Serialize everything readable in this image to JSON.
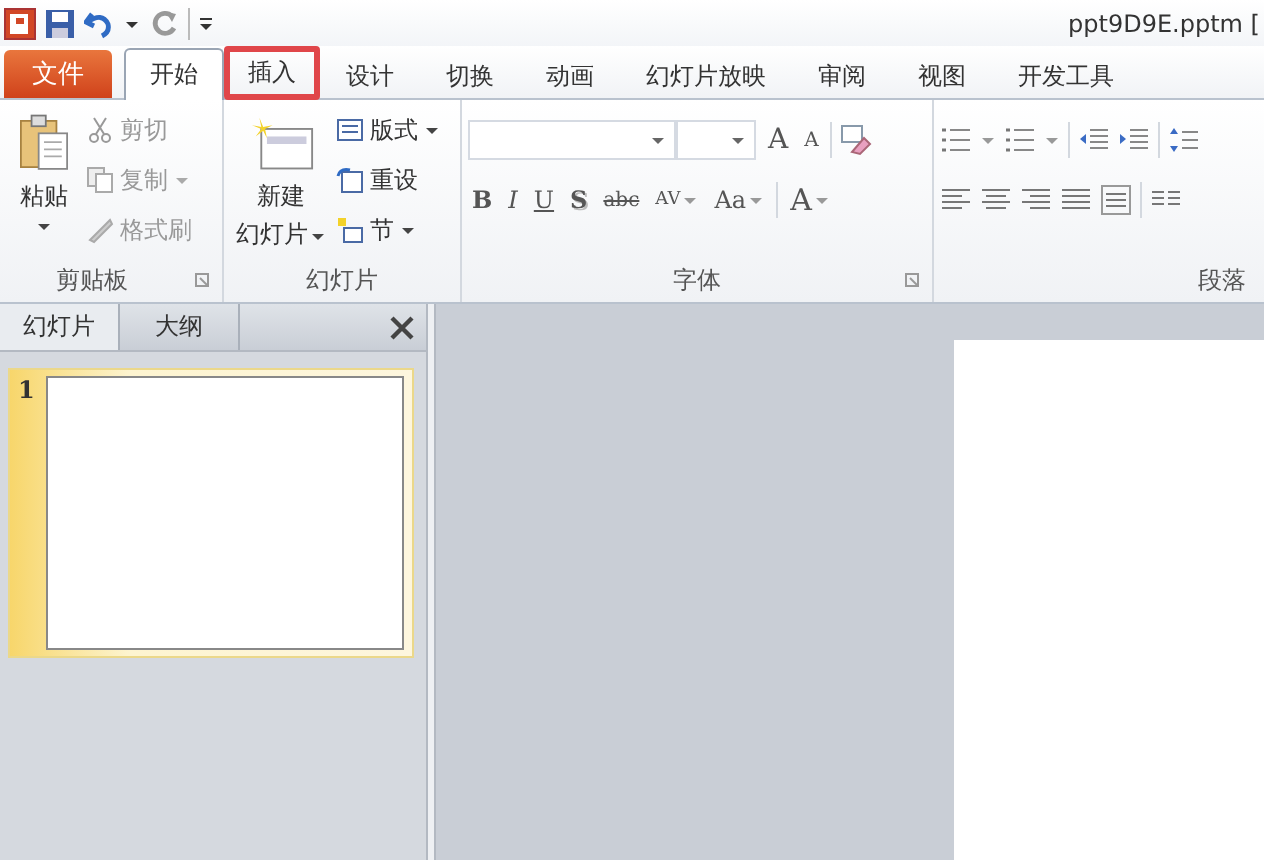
{
  "title_bar": {
    "title": "ppt9D9E.pptm ["
  },
  "file_tab": {
    "label": "文件"
  },
  "tabs": [
    {
      "label": "开始",
      "kind": "tab",
      "selected": true,
      "highlighted": false
    },
    {
      "label": "插入",
      "kind": "tab",
      "selected": false,
      "highlighted": true
    },
    {
      "label": "设计",
      "kind": "tab",
      "selected": false,
      "highlighted": false
    },
    {
      "label": "切换",
      "kind": "tab",
      "selected": false,
      "highlighted": false
    },
    {
      "label": "动画",
      "kind": "tab",
      "selected": false,
      "highlighted": false
    },
    {
      "label": "幻灯片放映",
      "kind": "tab",
      "selected": false,
      "highlighted": false
    },
    {
      "label": "审阅",
      "kind": "tab",
      "selected": false,
      "highlighted": false
    },
    {
      "label": "视图",
      "kind": "tab",
      "selected": false,
      "highlighted": false
    },
    {
      "label": "开发工具",
      "kind": "tab",
      "selected": false,
      "highlighted": false
    }
  ],
  "clipboard": {
    "label": "剪贴板",
    "paste": "粘贴",
    "items": [
      {
        "label": "剪切",
        "disabled": true,
        "dropdown": false
      },
      {
        "label": "复制",
        "disabled": true,
        "dropdown": true
      },
      {
        "label": "格式刷",
        "disabled": true,
        "dropdown": false
      }
    ]
  },
  "slides": {
    "label": "幻灯片",
    "new_slide": [
      "新建",
      "幻灯片"
    ],
    "items": [
      {
        "label": "版式",
        "dropdown": true
      },
      {
        "label": "重设",
        "dropdown": false
      },
      {
        "label": "节",
        "dropdown": true
      }
    ]
  },
  "font": {
    "label": "字体",
    "buttons": [
      {
        "label": "B",
        "dropdown": false
      },
      {
        "label": "I",
        "dropdown": false
      },
      {
        "label": "U",
        "dropdown": false
      },
      {
        "label": "S",
        "dropdown": false
      },
      {
        "label": "abc",
        "dropdown": false
      },
      {
        "label": "AV",
        "dropdown": true
      },
      {
        "label": "Aa",
        "dropdown": true
      },
      {
        "label": "A",
        "dropdown": true
      }
    ],
    "grow": "A",
    "shrink": "A"
  },
  "paragraph": {
    "label": "段落"
  },
  "panel": {
    "tabs": [
      {
        "label": "幻灯片",
        "selected": true
      },
      {
        "label": "大纲",
        "selected": false
      }
    ],
    "thumbnails": [
      {
        "number": "1",
        "selected": true
      }
    ]
  }
}
